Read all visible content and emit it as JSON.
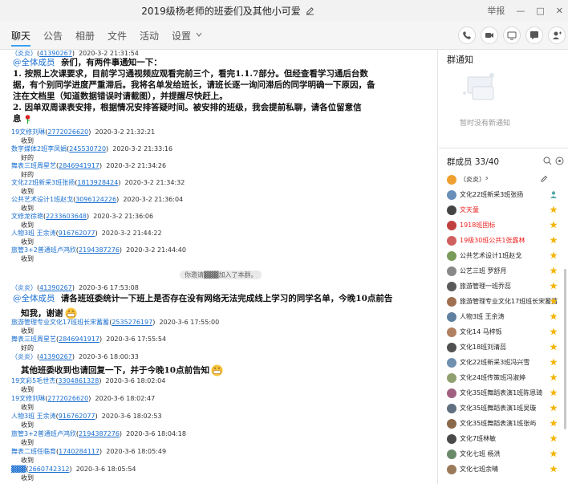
{
  "window": {
    "title": "2019级杨老师的班委们及其他小可爱",
    "controls": [
      "举报",
      "—",
      "□",
      "✕"
    ]
  },
  "tabs": [
    "聊天",
    "公告",
    "相册",
    "文件",
    "活动",
    "设置"
  ],
  "toolbar_icons": [
    "phone-icon",
    "video-icon",
    "screen-share-icon",
    "app-icon",
    "add-member-icon",
    "more-icon"
  ],
  "chat": {
    "msg1": {
      "sender": "（炎炎）",
      "qq": "41390267",
      "time": "2020-3-2 21:31:54",
      "line1_at": "@全体成员",
      "line1": "亲们，有两件事通知一下：",
      "line2": "1.      按照上次课要求，目前学习通视频应观看完前三个，看完1.1.7部分。但经查看学习通后台数",
      "line3": "据，有个别同学进度严重滞后。我将名单发给班长，请班长逐一询问滞后的同学明确一下原因，备",
      "line4": "注在文档里（知道数据错误时请截图），并提醒尽快赶上。",
      "line5": "2.      因单双周课表安排，根据情况安排答疑时间。被安排的班级，我会提前私聊，请各位留意信",
      "line6": "息"
    },
    "replies1": [
      {
        "name": "19文修刘琳",
        "qq": "2772026620",
        "time": "2020-3-2 21:32:21",
        "text": "收到"
      },
      {
        "name": "数字媒体2班李凤娟",
        "qq": "245530720",
        "time": "2020-3-2 21:33:16",
        "text": "好的"
      },
      {
        "name": "舞表三班周星艺",
        "qq": "2846941917",
        "time": "2020-3-2 21:34:26",
        "text": "好的"
      },
      {
        "name": "文化22班新采3班张扬",
        "qq": "1813928424",
        "time": "2020-3-2 21:34:32",
        "text": "收到"
      },
      {
        "name": "公共艺术设计1班赵戈",
        "qq": "3096124226",
        "time": "2020-3-2 21:36:04",
        "text": "收到"
      },
      {
        "name": "文修龙徐艳",
        "qq": "2233603648",
        "time": "2020-3-2 21:36:06",
        "text": "收到"
      },
      {
        "name": "人物3班    王余涛",
        "qq": "916762077",
        "time": "2020-3-2 21:44:22",
        "text": "收到"
      },
      {
        "name": "旅管3+2普通班卢鸿欣",
        "qq": "2194387276",
        "time": "2020-3-2 21:44:40",
        "text": "收到"
      }
    ],
    "system_note": "你邀请▓▓▓加入了本群。",
    "msg2": {
      "sender": "（炎炎）",
      "qq": "41390267",
      "time": "2020-3-6 17:53:08",
      "at": "@全体成员",
      "line1": "请各班班委统计一下班上是否存在没有网络无法完成线上学习的同学名单，今晚10点前告",
      "line2": "知我，谢谢"
    },
    "replies2": [
      {
        "name": "旅游管理专业文化17班班长宋蓄蓄",
        "qq": "2535276197",
        "time": "2020-3-6 17:55:00",
        "text": "收到"
      },
      {
        "name": "舞表三班周星艺",
        "qq": "2846941917",
        "time": "2020-3-6 17:55:54",
        "text": "好的"
      }
    ],
    "msg3": {
      "sender": "（炎炎）",
      "qq": "41390267",
      "time": "2020-3-6 18:00:33",
      "line1": "其他班委收到也请回复一下，并于今晚10点前告知"
    },
    "replies3": [
      {
        "name": "19文彩5毛世杰",
        "qq": "3304861328",
        "time": "2020-3-6 18:02:04",
        "text": "收到"
      },
      {
        "name": "19文修刘琳",
        "qq": "2772026620",
        "time": "2020-3-6 18:02:47",
        "text": "收到"
      },
      {
        "name": "人物3班    王余涛",
        "qq": "916762077",
        "time": "2020-3-6 18:02:53",
        "text": "收到"
      },
      {
        "name": "旅管3+2普通班卢鸿欣",
        "qq": "2194387276",
        "time": "2020-3-6 18:04:18",
        "text": "收到"
      },
      {
        "name": "舞表二班任临育",
        "qq": "1740284117",
        "time": "2020-3-6 18:05:49",
        "text": "收到"
      },
      {
        "name": "▓▓▓",
        "qq": "2660742312",
        "time": "2020-3-6 18:05:54",
        "text": "收到"
      }
    ]
  },
  "sidebar": {
    "notice_title": "群通知",
    "notice_empty": "暂时没有新通知",
    "members_title": "群成员 33/40",
    "members": [
      {
        "name": "（炎炎）³",
        "color": "#f0a030",
        "red": false
      },
      {
        "name": "文化22班新采3班张扬",
        "color": "#6a8fb8",
        "red": false
      },
      {
        "name": "文天童",
        "color": "#444",
        "red": true
      },
      {
        "name": "1918班固标",
        "color": "#c04040",
        "red": true
      },
      {
        "name": "19级30班公共1张露林",
        "color": "#d06060",
        "red": true
      },
      {
        "name": "公共艺术设计1班赵戈",
        "color": "#7a9a5a",
        "red": false
      },
      {
        "name": "公艺三班  罗舒月",
        "color": "#888",
        "red": false
      },
      {
        "name": "旅游管理一班乔蕊",
        "color": "#5a5a5a",
        "red": false
      },
      {
        "name": "旅游管理专业文化17班班长宋蓄蓄",
        "color": "#a07050",
        "red": false
      },
      {
        "name": "人物3班    王余涛",
        "color": "#6080a0",
        "red": false
      },
      {
        "name": "文化14  马梓铄",
        "color": "#b08060",
        "red": false
      },
      {
        "name": "文化18班刘清蕊",
        "color": "#505050",
        "red": false
      },
      {
        "name": "文化22班新采3班冯兴雪",
        "color": "#7090b0",
        "red": false
      },
      {
        "name": "文化24班传策班冯淑婷",
        "color": "#90a070",
        "red": false
      },
      {
        "name": "文化35班舞蹈表演1班陈恩琦",
        "color": "#a06080",
        "red": false
      },
      {
        "name": "文化35班舞蹈表演1班吴璇",
        "color": "#607080",
        "red": false
      },
      {
        "name": "文化35班舞蹈表演1班张屿",
        "color": "#8a6a4a",
        "red": false
      },
      {
        "name": "文化7班林敏",
        "color": "#4a4a4a",
        "red": false
      },
      {
        "name": "文化七班  杨洪",
        "color": "#6a8a6a",
        "red": false
      },
      {
        "name": "文化七班余晴",
        "color": "#9a7a5a",
        "red": false
      }
    ]
  }
}
